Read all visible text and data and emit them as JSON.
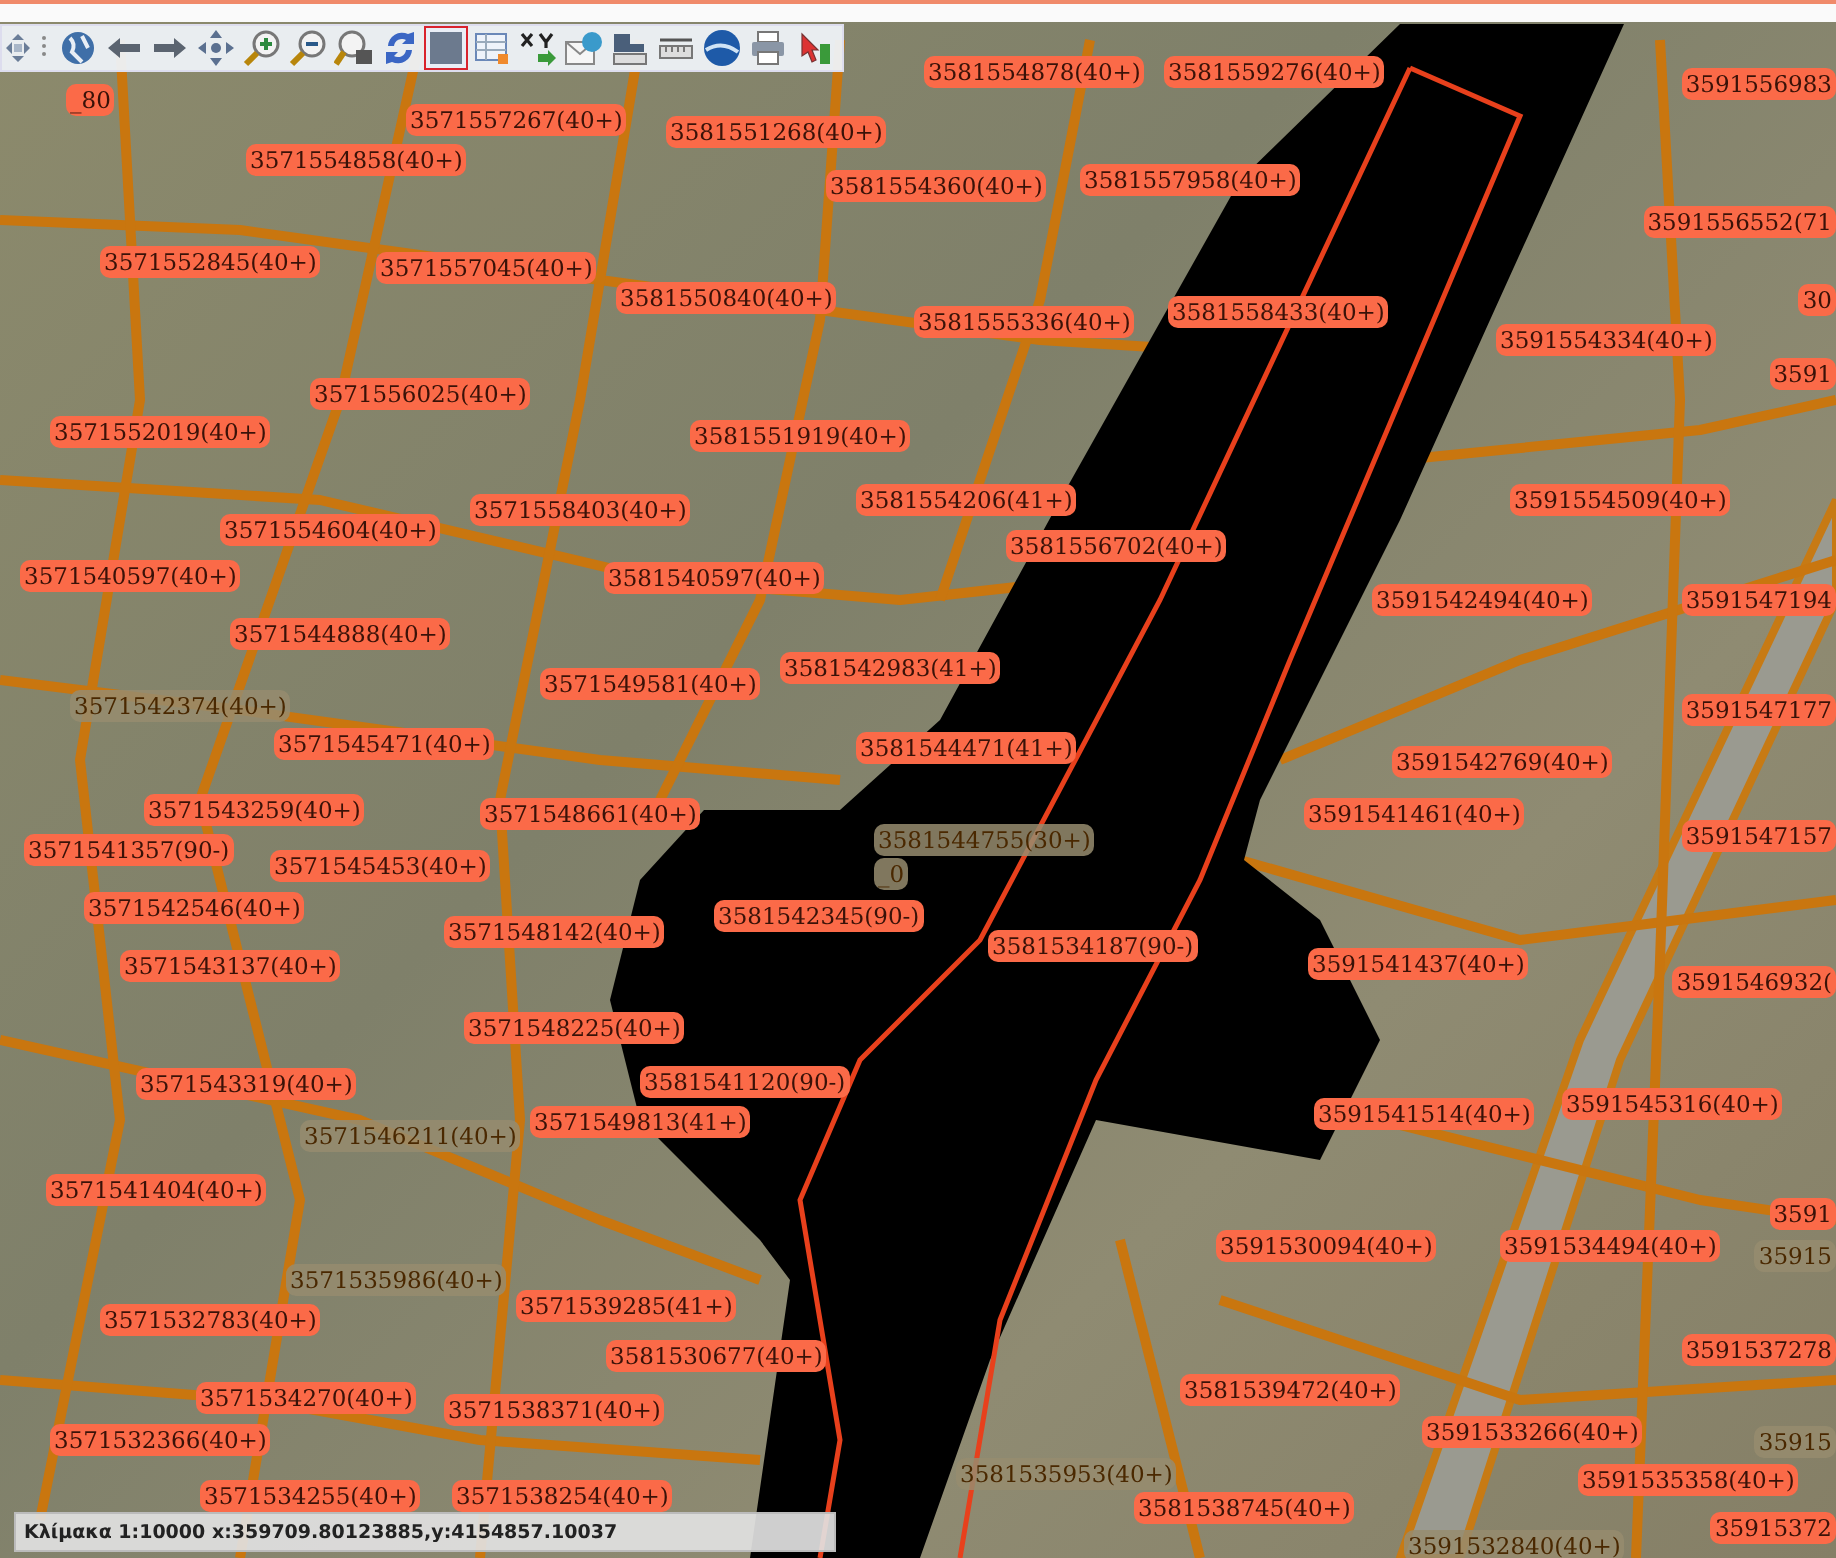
{
  "toolbar": {
    "tools": [
      {
        "kind": "globe",
        "selected": false
      },
      {
        "kind": "back",
        "selected": false
      },
      {
        "kind": "forward",
        "selected": false
      },
      {
        "kind": "pan",
        "selected": false
      },
      {
        "kind": "zoom-in",
        "selected": false
      },
      {
        "kind": "zoom-out",
        "selected": false
      },
      {
        "kind": "zoom-box",
        "selected": false
      },
      {
        "kind": "refresh",
        "selected": false
      },
      {
        "kind": "select",
        "selected": true
      },
      {
        "kind": "table",
        "selected": false
      },
      {
        "kind": "xy",
        "selected": false
      },
      {
        "kind": "mail",
        "selected": false
      },
      {
        "kind": "area",
        "selected": false
      },
      {
        "kind": "ruler",
        "selected": false
      },
      {
        "kind": "earth",
        "selected": false
      },
      {
        "kind": "print",
        "selected": false
      },
      {
        "kind": "tool",
        "selected": false
      }
    ]
  },
  "map": {
    "labels": [
      {
        "text": "_80",
        "kind": "boxed"
      },
      {
        "text": "3571557267(40+)",
        "kind": "boxed"
      },
      {
        "text": "3571554858(40+)",
        "kind": "boxed"
      },
      {
        "text": "3581551268(40+)",
        "kind": "boxed"
      },
      {
        "text": "3581554878(40+)",
        "kind": "boxed"
      },
      {
        "text": "3581559276(40+)",
        "kind": "boxed"
      },
      {
        "text": "3591556983",
        "kind": "boxed"
      },
      {
        "text": "3581554360(40+)",
        "kind": "boxed"
      },
      {
        "text": "3581557958(40+)",
        "kind": "boxed"
      },
      {
        "text": "3591556552(71",
        "kind": "boxed"
      },
      {
        "text": "3571552845(40+)",
        "kind": "boxed"
      },
      {
        "text": "3571557045(40+)",
        "kind": "boxed"
      },
      {
        "text": "3581550840(40+)",
        "kind": "boxed"
      },
      {
        "text": "3581555336(40+)",
        "kind": "boxed"
      },
      {
        "text": "3581558433(40+)",
        "kind": "boxed"
      },
      {
        "text": "30",
        "kind": "boxed"
      },
      {
        "text": "3591554334(40+)",
        "kind": "boxed"
      },
      {
        "text": "3591",
        "kind": "boxed"
      },
      {
        "text": "3571556025(40+)",
        "kind": "boxed"
      },
      {
        "text": "3571552019(40+)",
        "kind": "boxed"
      },
      {
        "text": "3581551919(40+)",
        "kind": "boxed"
      },
      {
        "text": "3581554206(41+)",
        "kind": "boxed"
      },
      {
        "text": "3591554509(40+)",
        "kind": "boxed"
      },
      {
        "text": "3571554604(40+)",
        "kind": "boxed"
      },
      {
        "text": "3571558403(40+)",
        "kind": "boxed"
      },
      {
        "text": "3581556702(40+)",
        "kind": "boxed"
      },
      {
        "text": "3571540597(40+)",
        "kind": "boxed"
      },
      {
        "text": "3581540597(40+)",
        "kind": "boxed"
      },
      {
        "text": "3591542494(40+)",
        "kind": "boxed"
      },
      {
        "text": "3591547194",
        "kind": "boxed"
      },
      {
        "text": "3571544888(40+)",
        "kind": "boxed"
      },
      {
        "text": "3581542983(41+)",
        "kind": "boxed"
      },
      {
        "text": "3571549581(40+)",
        "kind": "boxed"
      },
      {
        "text": "3571542374(40+)",
        "kind": "plain"
      },
      {
        "text": "3591547177",
        "kind": "boxed"
      },
      {
        "text": "3571545471(40+)",
        "kind": "boxed"
      },
      {
        "text": "3581544471(41+)",
        "kind": "boxed"
      },
      {
        "text": "3591542769(40+)",
        "kind": "boxed"
      },
      {
        "text": "3571543259(40+)",
        "kind": "boxed"
      },
      {
        "text": "3571548661(40+)",
        "kind": "boxed"
      },
      {
        "text": "3591541461(40+)",
        "kind": "boxed"
      },
      {
        "text": "3591547157",
        "kind": "boxed"
      },
      {
        "text": "3581544755(30+)",
        "kind": "plain"
      },
      {
        "text": "3571541357(90-)",
        "kind": "boxed"
      },
      {
        "text": "3571545453(40+)",
        "kind": "boxed"
      },
      {
        "text": "_0",
        "kind": "plain"
      },
      {
        "text": "3571542546(40+)",
        "kind": "boxed"
      },
      {
        "text": "3581542345(90-)",
        "kind": "boxed"
      },
      {
        "text": "3571548142(40+)",
        "kind": "boxed"
      },
      {
        "text": "3581534187(90-)",
        "kind": "boxed"
      },
      {
        "text": "3571543137(40+)",
        "kind": "boxed"
      },
      {
        "text": "3591541437(40+)",
        "kind": "boxed"
      },
      {
        "text": "3591546932(",
        "kind": "boxed"
      },
      {
        "text": "3571548225(40+)",
        "kind": "boxed"
      },
      {
        "text": "3571543319(40+)",
        "kind": "boxed"
      },
      {
        "text": "3581541120(90-)",
        "kind": "boxed"
      },
      {
        "text": "3571549813(41+)",
        "kind": "boxed"
      },
      {
        "text": "3571546211(40+)",
        "kind": "plain"
      },
      {
        "text": "3591541514(40+)",
        "kind": "boxed"
      },
      {
        "text": "3591545316(40+)",
        "kind": "boxed"
      },
      {
        "text": "3571541404(40+)",
        "kind": "boxed"
      },
      {
        "text": "3591",
        "kind": "boxed"
      },
      {
        "text": "3571535986(40+)",
        "kind": "plain"
      },
      {
        "text": "3591530094(40+)",
        "kind": "boxed"
      },
      {
        "text": "3591534494(40+)",
        "kind": "boxed"
      },
      {
        "text": "35915",
        "kind": "plain"
      },
      {
        "text": "3571539285(41+)",
        "kind": "boxed"
      },
      {
        "text": "3571532783(40+)",
        "kind": "boxed"
      },
      {
        "text": "3581530677(40+)",
        "kind": "boxed"
      },
      {
        "text": "3591537278",
        "kind": "boxed"
      },
      {
        "text": "3571534270(40+)",
        "kind": "boxed"
      },
      {
        "text": "3571538371(40+)",
        "kind": "boxed"
      },
      {
        "text": "3581539472(40+)",
        "kind": "boxed"
      },
      {
        "text": "3571532366(40+)",
        "kind": "boxed"
      },
      {
        "text": "3591533266(40+)",
        "kind": "boxed"
      },
      {
        "text": "35915",
        "kind": "plain"
      },
      {
        "text": "3571534255(40+)",
        "kind": "boxed"
      },
      {
        "text": "3571538254(40+)",
        "kind": "boxed"
      },
      {
        "text": "3581535953(40+)",
        "kind": "plain"
      },
      {
        "text": "3581538745(40+)",
        "kind": "boxed"
      },
      {
        "text": "3591535358(40+)",
        "kind": "boxed"
      },
      {
        "text": "35915372",
        "kind": "boxed"
      },
      {
        "text": "3591532840(40+)",
        "kind": "plain"
      }
    ]
  },
  "status_bar": {
    "text": "Κλίμακα 1:10000 x:359709.80123885,y:4154857.10037"
  }
}
